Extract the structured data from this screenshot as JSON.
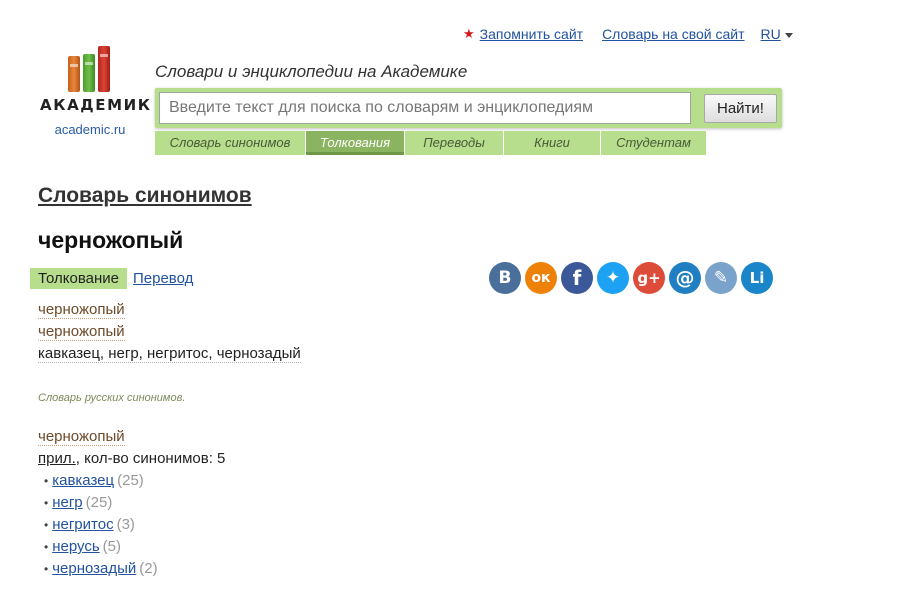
{
  "header": {
    "remember_link": "Запомнить сайт",
    "dictionary_link": "Словарь на свой сайт",
    "language": "RU",
    "tagline": "Словари и энциклопедии на Академике"
  },
  "logo": {
    "title": "АКАДЕМИК",
    "url": "academic.ru"
  },
  "search": {
    "placeholder": "Введите текст для поиска по словарям и энциклопедиям",
    "value": "",
    "button_label": "Найти!"
  },
  "tabs": [
    {
      "label": "Словарь синонимов",
      "active": false
    },
    {
      "label": "Толкования",
      "active": true
    },
    {
      "label": "Переводы",
      "active": false
    },
    {
      "label": "Книги",
      "active": false
    },
    {
      "label": "Студентам",
      "active": false
    }
  ],
  "content": {
    "dictionary_title": "Словарь синонимов",
    "headword": "черножопый",
    "mode_active": "Толкование",
    "mode_link": "Перевод",
    "entry1_line1": "черножопый",
    "entry1_line2": "черножопый",
    "entry1_synonyms": "кавказец, негр, негритос, чернозадый",
    "source": "Словарь русских синонимов.",
    "entry2_word": "черножопый",
    "entry2_pos": "прил.",
    "entry2_count_text": ", кол-во синонимов: 5",
    "synonyms": [
      {
        "word": "кавказец",
        "count": "(25)"
      },
      {
        "word": "негр",
        "count": "(25)"
      },
      {
        "word": "негритос",
        "count": "(3)"
      },
      {
        "word": "нерусь",
        "count": "(5)"
      },
      {
        "word": "чернозадый",
        "count": "(2)"
      }
    ]
  },
  "share": [
    {
      "name": "vkontakte",
      "glyph": "В",
      "color": "#4a6f9a"
    },
    {
      "name": "odnoklassniki",
      "glyph": "ок",
      "color": "#ee8208"
    },
    {
      "name": "facebook",
      "glyph": "f",
      "color": "#3b5998"
    },
    {
      "name": "twitter",
      "glyph": "✦",
      "color": "#1da1f2"
    },
    {
      "name": "google-plus",
      "glyph": "g+",
      "color": "#dd4b39"
    },
    {
      "name": "mail",
      "glyph": "@",
      "color": "#1f7fc2"
    },
    {
      "name": "livejournal",
      "glyph": "✎",
      "color": "#7aa3cc"
    },
    {
      "name": "liveinternet",
      "glyph": "Li",
      "color": "#1a86c9"
    }
  ]
}
